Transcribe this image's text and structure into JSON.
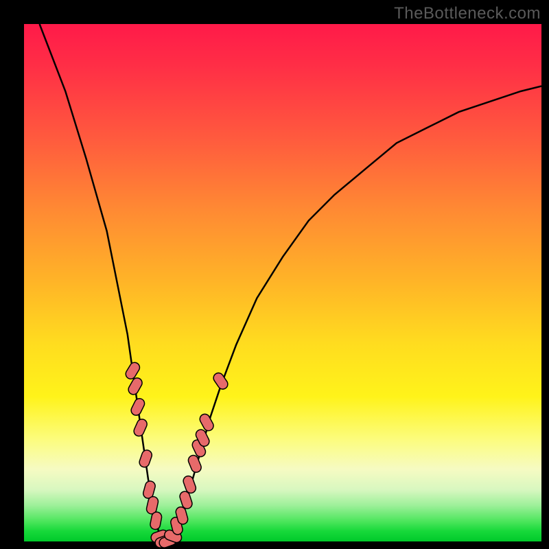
{
  "watermark": "TheBottleneck.com",
  "colors": {
    "frame": "#000000",
    "curve_stroke": "#000000",
    "marker_fill": "#e76a6a",
    "marker_stroke": "#000000"
  },
  "chart_data": {
    "type": "line",
    "title": "",
    "xlabel": "",
    "ylabel": "",
    "xlim": [
      0,
      100
    ],
    "ylim": [
      0,
      100
    ],
    "grid": false,
    "x": [
      3,
      8,
      12,
      16,
      18,
      20,
      21,
      22,
      23,
      24,
      25,
      26,
      27,
      28,
      29,
      30,
      31,
      32,
      34,
      36,
      38,
      41,
      45,
      50,
      55,
      60,
      66,
      72,
      78,
      84,
      90,
      96,
      100
    ],
    "bottleneck_pct": [
      100,
      87,
      74,
      60,
      50,
      40,
      33,
      26,
      19,
      12,
      6,
      2,
      0,
      0,
      1,
      3,
      6,
      10,
      17,
      24,
      30,
      38,
      47,
      55,
      62,
      67,
      72,
      77,
      80,
      83,
      85,
      87,
      88
    ],
    "markers_left": [
      {
        "x": 21.0,
        "b": 33
      },
      {
        "x": 21.5,
        "b": 30
      },
      {
        "x": 22.0,
        "b": 26
      },
      {
        "x": 22.5,
        "b": 22
      },
      {
        "x": 23.5,
        "b": 16
      },
      {
        "x": 24.2,
        "b": 10
      },
      {
        "x": 24.8,
        "b": 7
      },
      {
        "x": 25.5,
        "b": 4
      },
      {
        "x": 26.2,
        "b": 1
      },
      {
        "x": 27.0,
        "b": 0
      },
      {
        "x": 27.8,
        "b": 0
      }
    ],
    "markers_right": [
      {
        "x": 28.8,
        "b": 1
      },
      {
        "x": 29.5,
        "b": 3
      },
      {
        "x": 30.5,
        "b": 5
      },
      {
        "x": 31.3,
        "b": 8
      },
      {
        "x": 32.0,
        "b": 11
      },
      {
        "x": 33.0,
        "b": 15
      },
      {
        "x": 33.8,
        "b": 18
      },
      {
        "x": 34.5,
        "b": 20
      },
      {
        "x": 35.3,
        "b": 23
      },
      {
        "x": 38.0,
        "b": 31
      }
    ]
  }
}
